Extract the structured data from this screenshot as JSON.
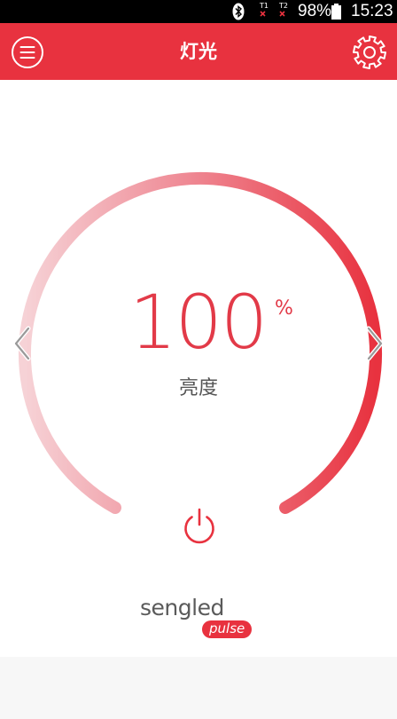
{
  "status_bar": {
    "battery_percent": "98%",
    "time": "15:23",
    "sim1_label": "T1",
    "sim2_label": "T2",
    "icons": [
      "bluetooth-icon",
      "sim1-no-signal-icon",
      "sim2-no-signal-icon",
      "battery-icon"
    ]
  },
  "header": {
    "title": "灯光",
    "background_color": "#e8323f",
    "left_icon": "menu-icon",
    "right_icon": "gear-icon"
  },
  "brightness": {
    "value": "100",
    "unit": "%",
    "label": "亮度",
    "level": 1.0,
    "arc_color_start": "#f6cfd3",
    "arc_color_end": "#e8323f"
  },
  "controls": {
    "prev_icon": "chevron-left-icon",
    "next_icon": "chevron-right-icon",
    "power_icon": "power-icon"
  },
  "brand": {
    "name": "sengled",
    "product": "pulse"
  }
}
